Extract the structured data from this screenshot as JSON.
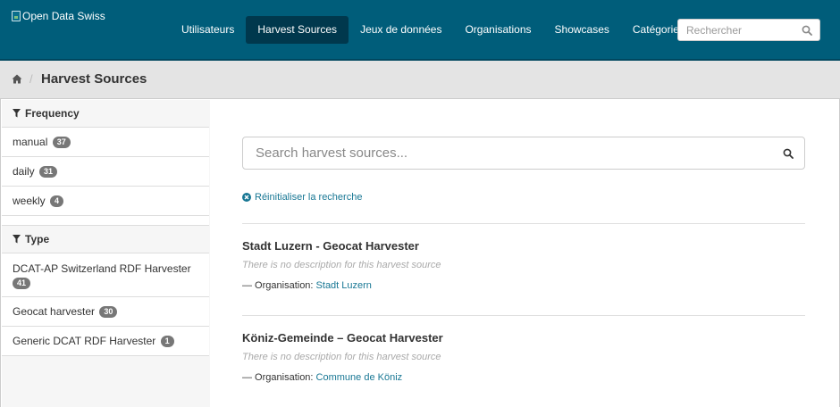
{
  "header": {
    "logo_alt": "Open Data Swiss",
    "nav": [
      {
        "label": "Utilisateurs",
        "active": false
      },
      {
        "label": "Harvest Sources",
        "active": true
      },
      {
        "label": "Jeux de données",
        "active": false
      },
      {
        "label": "Organisations",
        "active": false
      },
      {
        "label": "Showcases",
        "active": false
      },
      {
        "label": "Catégories",
        "active": false
      }
    ],
    "search_placeholder": "Rechercher",
    "brand_color": "#005d7a"
  },
  "breadcrumb": {
    "separator": "/",
    "title": "Harvest Sources"
  },
  "facets": {
    "frequency": {
      "title": "Frequency",
      "items": [
        {
          "label": "manual",
          "count": "37"
        },
        {
          "label": "daily",
          "count": "31"
        },
        {
          "label": "weekly",
          "count": "4"
        }
      ]
    },
    "type": {
      "title": "Type",
      "items": [
        {
          "label": "DCAT-AP Switzerland RDF Harvester",
          "count": "41"
        },
        {
          "label": "Geocat harvester",
          "count": "30"
        },
        {
          "label": "Generic DCAT RDF Harvester",
          "count": "1"
        }
      ]
    }
  },
  "main": {
    "search_placeholder": "Search harvest sources...",
    "reset_label": "Réinitialiser la recherche",
    "org_prefix": "— Organisation:",
    "sources": [
      {
        "title": "Stadt Luzern - Geocat Harvester",
        "description": "There is no description for this harvest source",
        "organisation": "Stadt Luzern"
      },
      {
        "title": "Köniz-Gemeinde – Geocat Harvester",
        "description": "There is no description for this harvest source",
        "organisation": "Commune de Köniz"
      }
    ]
  }
}
